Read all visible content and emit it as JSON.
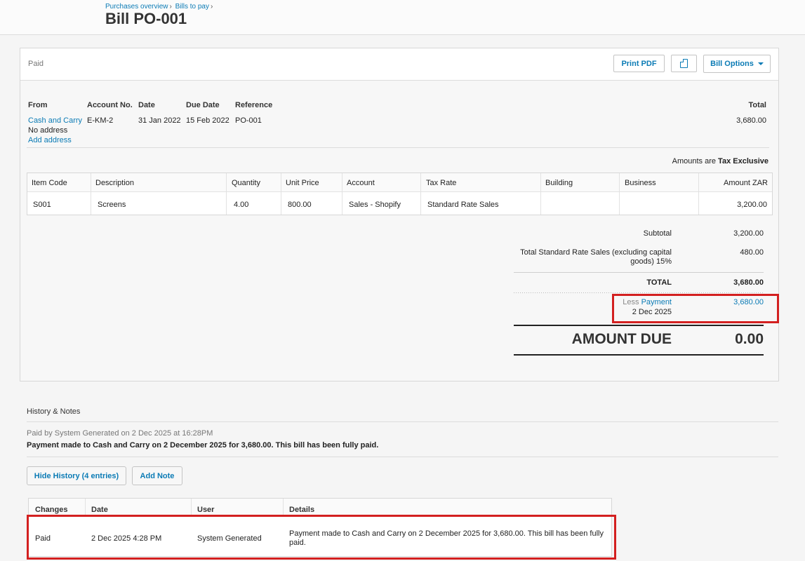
{
  "breadcrumb": {
    "items": [
      "Purchases overview",
      "Bills to pay"
    ]
  },
  "page_title": "Bill PO-001",
  "status": "Paid",
  "toolbar": {
    "print_label": "Print PDF",
    "copy_icon": "copy-icon",
    "options_label": "Bill Options"
  },
  "bill": {
    "headers": {
      "from": "From",
      "account_no": "Account No.",
      "date": "Date",
      "due_date": "Due Date",
      "reference": "Reference",
      "total": "Total"
    },
    "from_name": "Cash and Carry",
    "no_address": "No address",
    "add_address": "Add address",
    "account_no": "E-KM-2",
    "date": "31 Jan 2022",
    "due_date": "15 Feb 2022",
    "reference": "PO-001",
    "total": "3,680.00",
    "amounts_are_prefix": "Amounts are",
    "amounts_are_value": "Tax Exclusive"
  },
  "items_table": {
    "columns": [
      "Item Code",
      "Description",
      "Quantity",
      "Unit Price",
      "Account",
      "Tax Rate",
      "Building",
      "Business",
      "Amount ZAR"
    ],
    "rows": [
      [
        "S001",
        "Screens",
        "4.00",
        "800.00",
        "Sales - Shopify",
        "Standard Rate Sales",
        "",
        "",
        "3,200.00"
      ]
    ]
  },
  "totals": {
    "subtotal_label": "Subtotal",
    "subtotal": "3,200.00",
    "tax_label_1": "Total Standard Rate Sales (excluding capital",
    "tax_label_2": "goods) 15%",
    "tax": "480.00",
    "total_label": "TOTAL",
    "total": "3,680.00",
    "less_label": "Less",
    "payment_label": "Payment",
    "payment_date": "2 Dec 2025",
    "payment_amount": "3,680.00",
    "amount_due_label": "AMOUNT DUE",
    "amount_due": "0.00"
  },
  "history": {
    "title": "History & Notes",
    "latest_meta": "Paid by System Generated on 2 Dec 2025 at 16:28PM",
    "latest_details": "Payment made to Cash and Carry on 2 December 2025 for 3,680.00. This bill has been fully paid.",
    "hide_button": "Hide History (4 entries)",
    "add_note_button": "Add Note",
    "columns": [
      "Changes",
      "Date",
      "User",
      "Details"
    ],
    "rows": [
      {
        "change": "Paid",
        "date": "2 Dec 2025 4:28 PM",
        "user": "System Generated",
        "details_1": "Payment made to Cash and Carry on 2 December 2025 for 3,680.00. This bill has been fully",
        "details_2": "paid."
      }
    ]
  },
  "colors": {
    "accent": "#0b7bb5",
    "highlight": "#d32020"
  }
}
